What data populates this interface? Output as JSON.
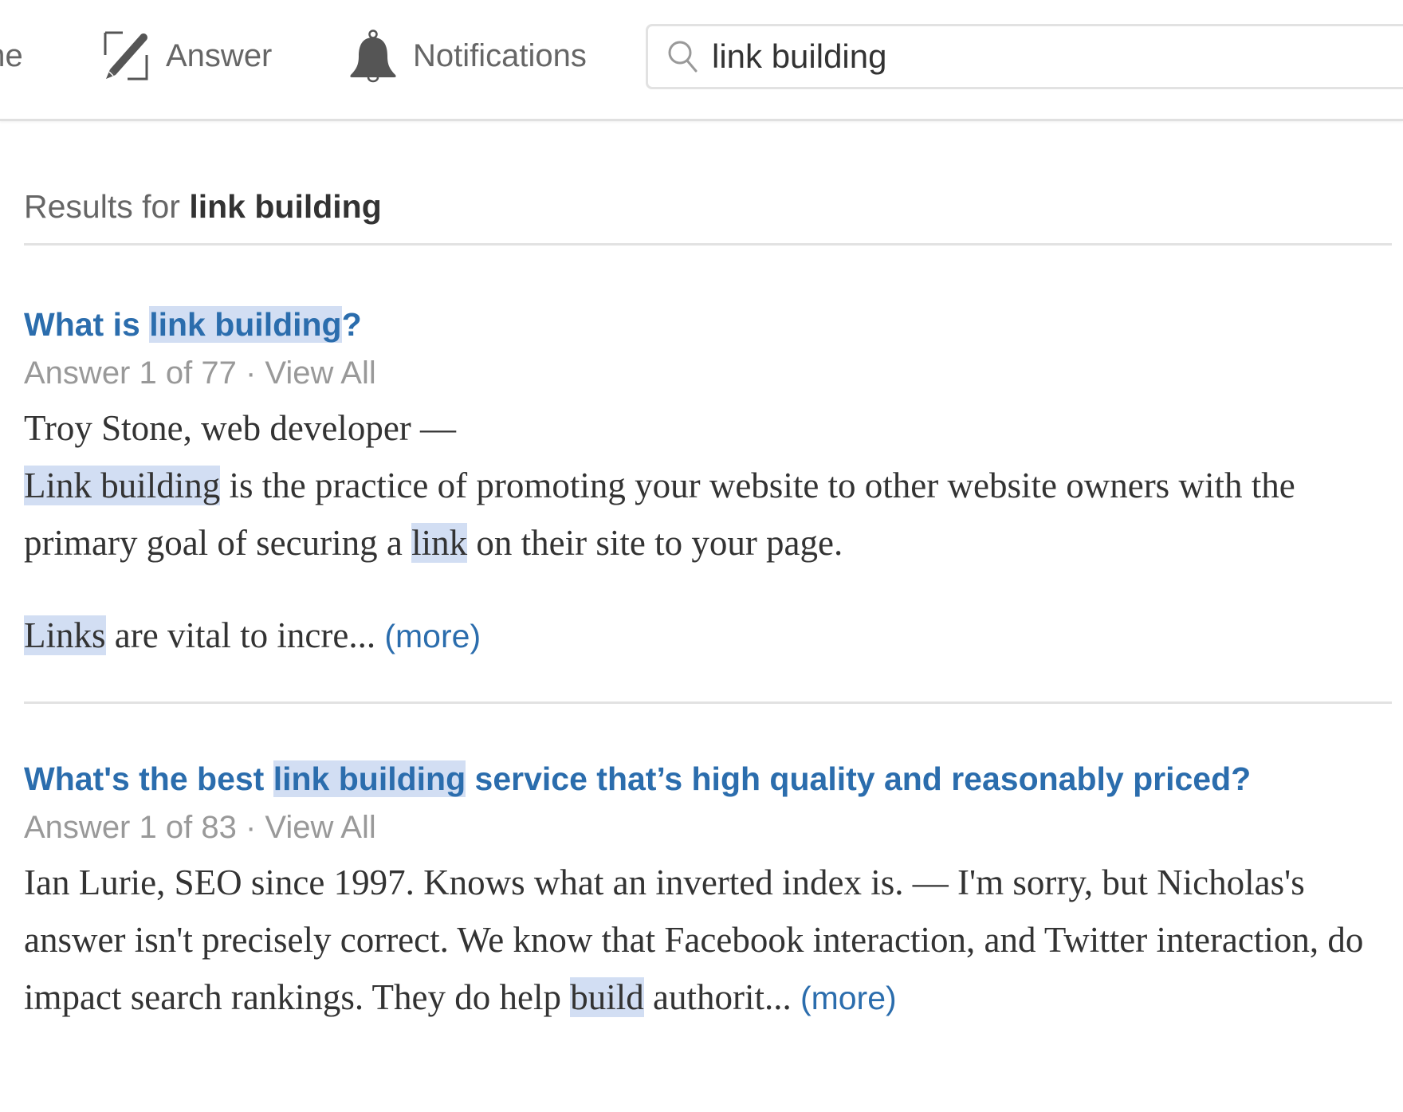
{
  "header": {
    "nav": [
      {
        "label": "Home",
        "visible_label": "ne",
        "icon": "home-icon"
      },
      {
        "label": "Answer",
        "icon": "pencil-edit-icon"
      },
      {
        "label": "Notifications",
        "icon": "bell-icon"
      }
    ],
    "search": {
      "icon": "search-icon",
      "value": "link building",
      "placeholder": ""
    }
  },
  "results": {
    "prefix": "Results for",
    "query": "link building",
    "items": [
      {
        "title_before": "What is ",
        "title_highlight": "link building",
        "title_after": "?",
        "meta_answer": "Answer 1 of 77",
        "meta_sep": " · ",
        "meta_view_all": "View All",
        "author_line": "Troy Stone, web developer —",
        "body": [
          {
            "hl1": "Link building",
            "t1": " is the practice of promoting your website to other website owners with the primary goal of securing a ",
            "hl2": "link",
            "t2": " on their site to your page."
          },
          {
            "hl1": "Links",
            "t1": " are vital to incre... "
          }
        ],
        "more_label": "(more)"
      },
      {
        "title_before": "What's the best ",
        "title_highlight": "link building",
        "title_after": " service that’s high quality and reasonably priced?",
        "meta_answer": "Answer 1 of 83",
        "meta_sep": " · ",
        "meta_view_all": "View All",
        "body_text": "Ian Lurie, SEO since 1997. Knows what an inverted index is. — I'm sorry, but Nicholas's answer isn't precisely correct. We know that Facebook interaction, and Twitter interaction, do impact search rankings. They do help ",
        "body_highlight": "build",
        "body_tail": " authorit... ",
        "more_label": "(more)"
      }
    ]
  },
  "colors": {
    "link_blue": "#2b6dad",
    "highlight": "#d2def3",
    "meta_gray": "#999999",
    "text_dark": "#333333",
    "nav_gray": "#666666",
    "divider": "#e2e2e2"
  }
}
